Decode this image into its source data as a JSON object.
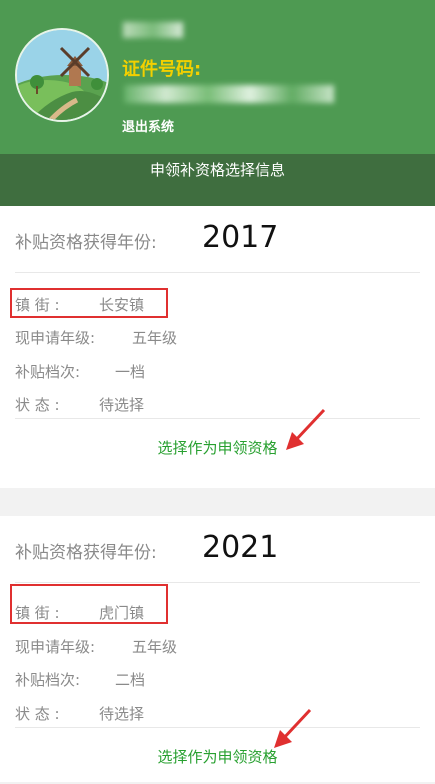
{
  "header": {
    "id_label": "证件号码:",
    "logout_label": "退出系统"
  },
  "subbar": {
    "title": "申领补资格选择信息"
  },
  "records": [
    {
      "year_label": "补贴资格获得年份:",
      "year": "2017",
      "town_label": "镇 街 :",
      "town": "长安镇",
      "grade_label": "现申请年级:",
      "grade": "五年级",
      "tier_label": "补贴档次:",
      "tier": "一档",
      "status_label": "状 态 :",
      "status": "待选择",
      "action_label": "选择作为申领资格"
    },
    {
      "year_label": "补贴资格获得年份:",
      "year": "2021",
      "town_label": "镇 街 :",
      "town": "虎门镇",
      "grade_label": "现申请年级:",
      "grade": "五年级",
      "tier_label": "补贴档次:",
      "tier": "二档",
      "status_label": "状 态 :",
      "status": "待选择",
      "action_label": "选择作为申领资格"
    }
  ],
  "colors": {
    "header_green": "#4e9a52",
    "subbar_green": "#3f6e3f",
    "id_label_yellow": "#f3d000",
    "action_green": "#28a030",
    "highlight_red": "#e03030"
  }
}
